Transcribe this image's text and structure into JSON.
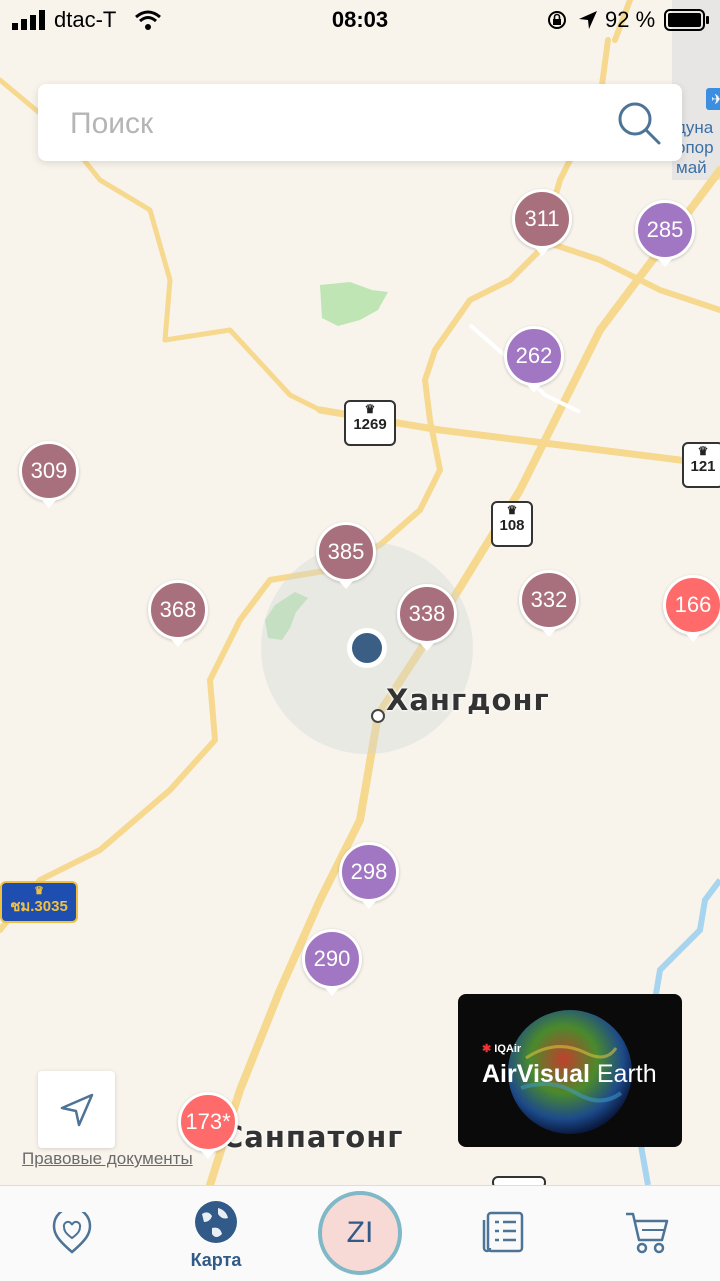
{
  "status_bar": {
    "carrier": "dtac-T",
    "time": "08:03",
    "battery": "92 %"
  },
  "search": {
    "placeholder": "Поиск"
  },
  "map": {
    "places": [
      "Хангдонг",
      "Санпатонг"
    ],
    "road_signs": [
      "1269",
      "108",
      "121",
      "ชม.3035"
    ],
    "stations": [
      {
        "aqi": "311",
        "level": "maroon"
      },
      {
        "aqi": "285",
        "level": "purple"
      },
      {
        "aqi": "262",
        "level": "purple"
      },
      {
        "aqi": "309",
        "level": "maroon"
      },
      {
        "aqi": "385",
        "level": "maroon"
      },
      {
        "aqi": "368",
        "level": "maroon"
      },
      {
        "aqi": "338",
        "level": "maroon"
      },
      {
        "aqi": "332",
        "level": "maroon"
      },
      {
        "aqi": "166",
        "level": "red"
      },
      {
        "aqi": "298",
        "level": "purple"
      },
      {
        "aqi": "290",
        "level": "purple"
      },
      {
        "aqi": "173*",
        "level": "red"
      }
    ],
    "airport_label": "дуна\nопор\nмай",
    "colors": {
      "maroon": "#a8707c",
      "purple": "#a176c2",
      "red": "#ff6a6a",
      "user_dot": "#3b5e85",
      "road": "#f6d98f",
      "water": "#a7d4ee",
      "park": "#bfe5b5"
    }
  },
  "legal_link": "Правовые документы",
  "promo": {
    "brand": "IQAir",
    "title_bold": "AirVisual",
    "title_rest": " Earth"
  },
  "tabbar": {
    "tabs": [
      {
        "icon": "heart-location-icon",
        "label": ""
      },
      {
        "icon": "globe-icon",
        "label": "Карта"
      },
      {
        "icon": "profile-initials",
        "label": "ZI"
      },
      {
        "icon": "news-list-icon",
        "label": ""
      },
      {
        "icon": "cart-icon",
        "label": ""
      }
    ]
  }
}
